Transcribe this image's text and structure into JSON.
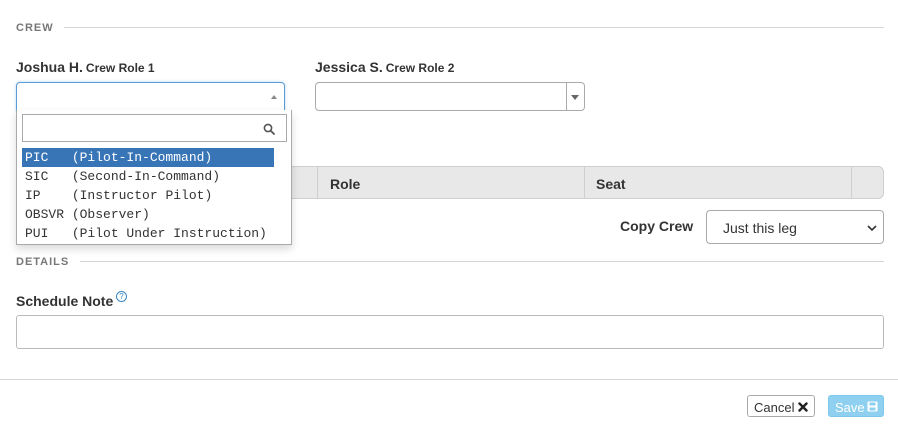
{
  "crew_section": {
    "title": "CREW"
  },
  "crew1": {
    "name": "Joshua H.",
    "role_label": "Crew Role 1",
    "value": ""
  },
  "crew2": {
    "name": "Jessica S.",
    "role_label": "Crew Role 2",
    "value": ""
  },
  "dropdown": {
    "search_value": "",
    "options": [
      {
        "code": "PIC",
        "desc": "(Pilot-In-Command)",
        "selected": true
      },
      {
        "code": "SIC",
        "desc": "(Second-In-Command)",
        "selected": false
      },
      {
        "code": "IP",
        "desc": "(Instructor Pilot)",
        "selected": false
      },
      {
        "code": "OBSVR",
        "desc": "(Observer)",
        "selected": false
      },
      {
        "code": "PUI",
        "desc": "(Pilot Under Instruction)",
        "selected": false
      }
    ]
  },
  "table": {
    "col_role": "Role",
    "col_seat": "Seat"
  },
  "copy_crew": {
    "label": "Copy Crew",
    "selected": "Just this leg"
  },
  "details": {
    "title": "DETAILS",
    "note_label": "Schedule Note",
    "note_value": "",
    "help_icon": "?"
  },
  "footer": {
    "cancel_label": "Cancel",
    "save_label": "Save"
  },
  "colors": {
    "highlight": "#3875b7",
    "save_bg": "#8fd0f0",
    "link": "#3a87c8"
  }
}
